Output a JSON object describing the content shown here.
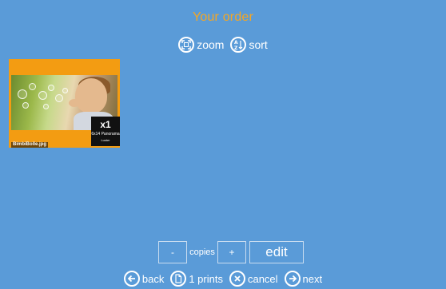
{
  "header": {
    "title": "Your order"
  },
  "toolbar": {
    "zoom_label": "zoom",
    "sort_label": "sort"
  },
  "order_items": [
    {
      "filename": "BimbiBolle.jpg",
      "quantity": "x1",
      "size": "6x14 Panorama",
      "finish": "Luster"
    }
  ],
  "copies": {
    "minus_label": "-",
    "label": "copies",
    "plus_label": "+",
    "edit_label": "edit"
  },
  "footer": {
    "back_label": "back",
    "prints_label": "1 prints",
    "cancel_label": "cancel",
    "next_label": "next"
  },
  "colors": {
    "background": "#5a9bd8",
    "accent": "#f5a623",
    "thumb_frame": "#f39c12"
  },
  "icons": {
    "zoom": "expand-icon",
    "sort": "sort-az-icon",
    "back": "arrow-left-icon",
    "prints": "document-icon",
    "cancel": "close-icon",
    "next": "arrow-right-icon"
  }
}
